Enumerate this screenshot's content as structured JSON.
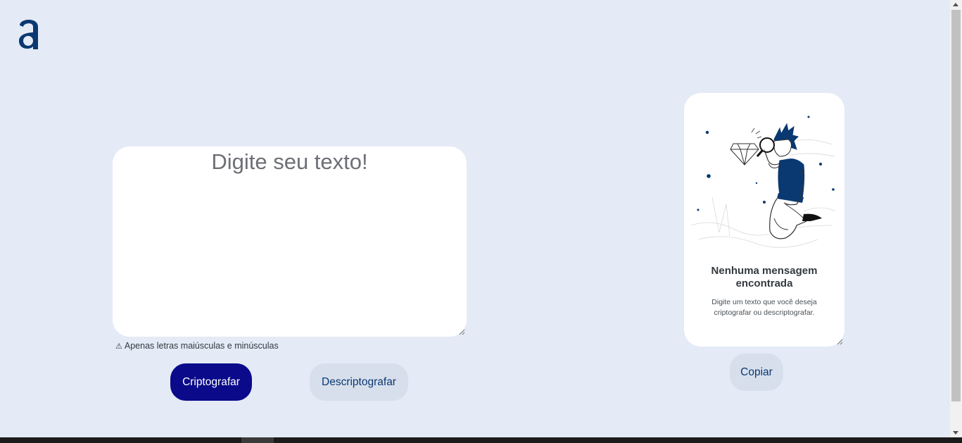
{
  "logo": {
    "icon": "alura-a-logo",
    "color": "#0a3871"
  },
  "input": {
    "placeholder": "Digite seu texto!",
    "value": ""
  },
  "warning": {
    "icon": "warning-icon",
    "text": "Apenas letras maiúsculas e minúsculas"
  },
  "buttons": {
    "encrypt_label": "Criptografar",
    "decrypt_label": "Descriptografar",
    "copy_label": "Copiar"
  },
  "output": {
    "illustration": "person-with-magnifying-glass-illustration",
    "empty_title": "Nenhuma mensagem encontrada",
    "empty_description": "Digite um texto que você deseja criptografar ou descriptografar."
  },
  "colors": {
    "background": "#e4eaf6",
    "primary": "#0a0a8a",
    "secondary_button": "#d8dfec",
    "brand": "#0a3871"
  }
}
